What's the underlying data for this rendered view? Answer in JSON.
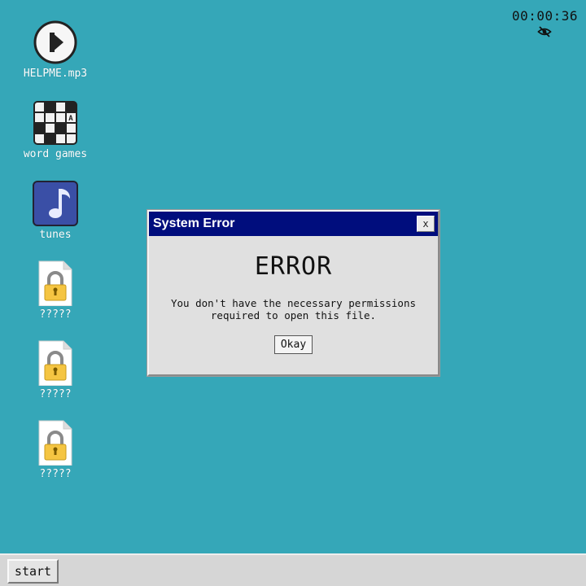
{
  "clock": {
    "time": "00:00:36",
    "indicator_icon": "eye-slash-icon"
  },
  "desktop": {
    "icons": [
      {
        "label": "HELPME.mp3",
        "icon": "play-icon"
      },
      {
        "label": "word games",
        "icon": "crossword-icon"
      },
      {
        "label": "tunes",
        "icon": "music-note-icon"
      },
      {
        "label": "?????",
        "icon": "locked-file-icon"
      },
      {
        "label": "?????",
        "icon": "locked-file-icon"
      },
      {
        "label": "?????",
        "icon": "locked-file-icon"
      }
    ]
  },
  "dialog": {
    "title": "System Error",
    "close_label": "x",
    "heading": "ERROR",
    "message": "You don't have the necessary permissions required to open this file.",
    "ok_label": "Okay"
  },
  "taskbar": {
    "start_label": "start"
  },
  "colors": {
    "desktop_bg": "#35a7b8",
    "titlebar_bg": "#000d7d",
    "dialog_bg": "#e0e0e0",
    "taskbar_bg": "#d6d6d6",
    "tunes_icon_bg": "#3a4fa6",
    "lock_yellow": "#f5c542"
  }
}
